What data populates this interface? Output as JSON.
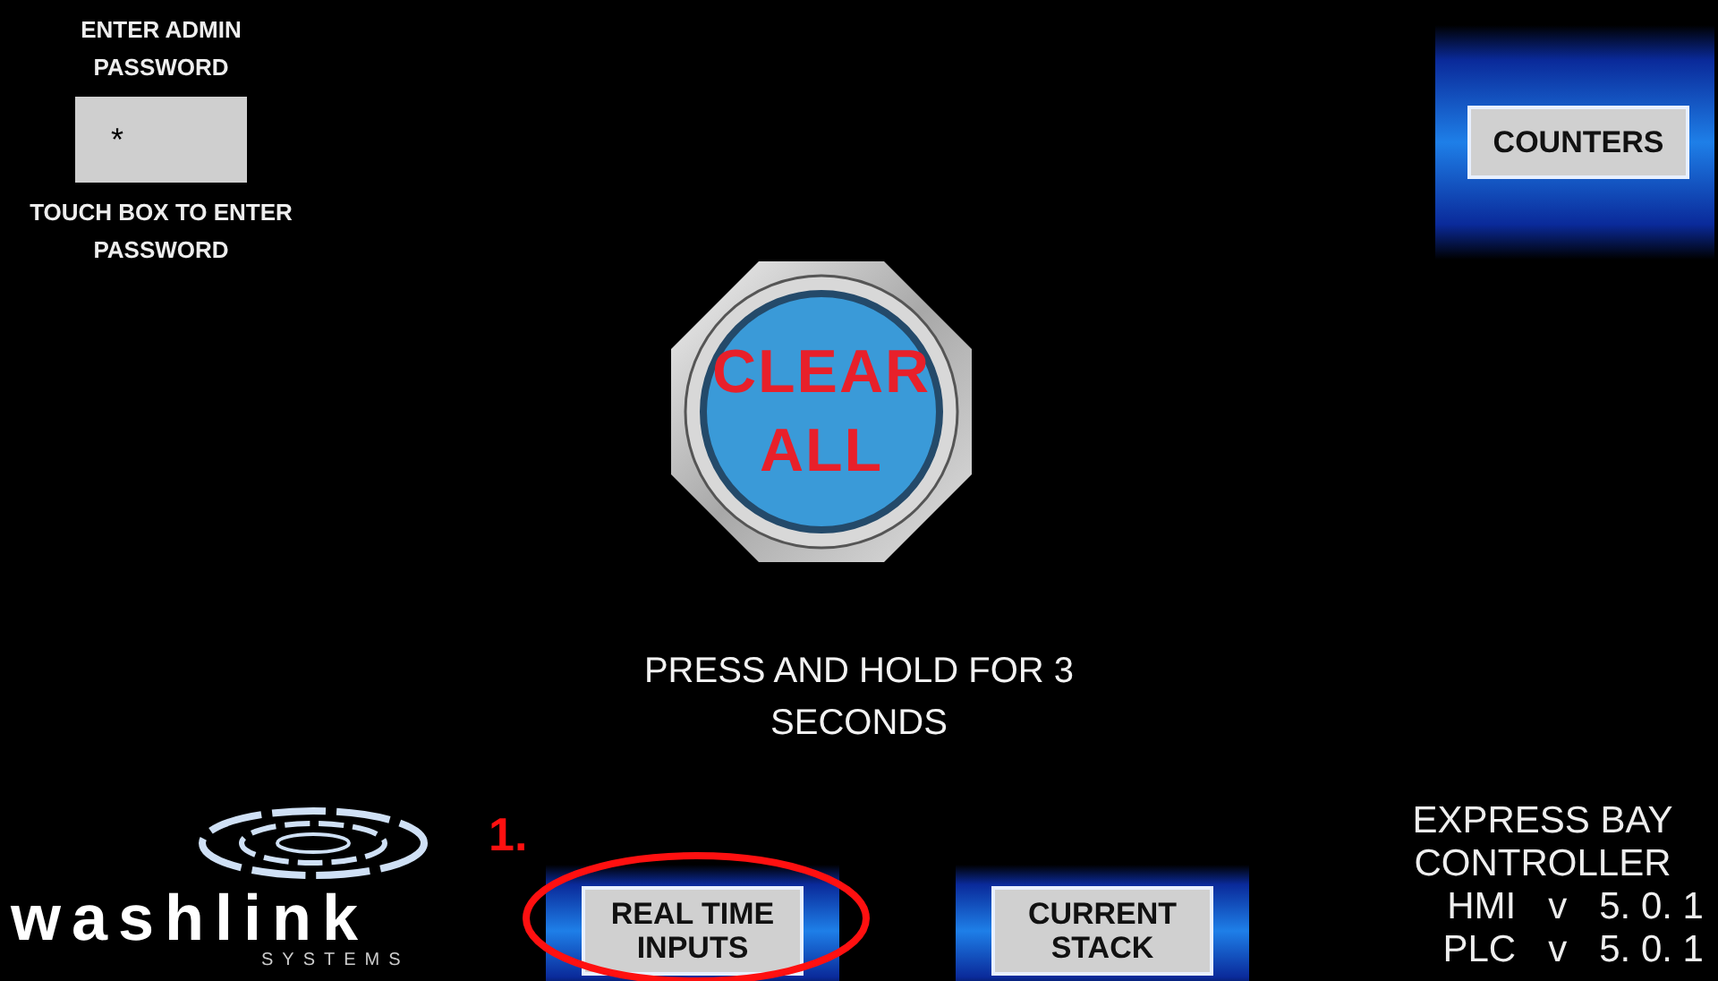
{
  "password": {
    "label": "ENTER ADMIN PASSWORD",
    "value": "*",
    "hint": "TOUCH BOX TO ENTER PASSWORD"
  },
  "counters_button": {
    "label": "COUNTERS"
  },
  "clear_button": {
    "label": "CLEAR ALL",
    "instruction": "PRESS AND HOLD FOR 3 SECONDS"
  },
  "logo": {
    "name": "washlink",
    "subtitle": "SYSTEMS"
  },
  "nav_buttons": [
    {
      "label": "REAL TIME INPUTS",
      "annotation": "1."
    },
    {
      "label": "CURRENT STACK"
    }
  ],
  "controller": {
    "title": "EXPRESS BAY CONTROLLER",
    "versions": [
      {
        "label": "HMI",
        "prefix": "v",
        "number": "5. 0. 1"
      },
      {
        "label": "PLC",
        "prefix": "v",
        "number": "5. 0. 1"
      }
    ]
  }
}
